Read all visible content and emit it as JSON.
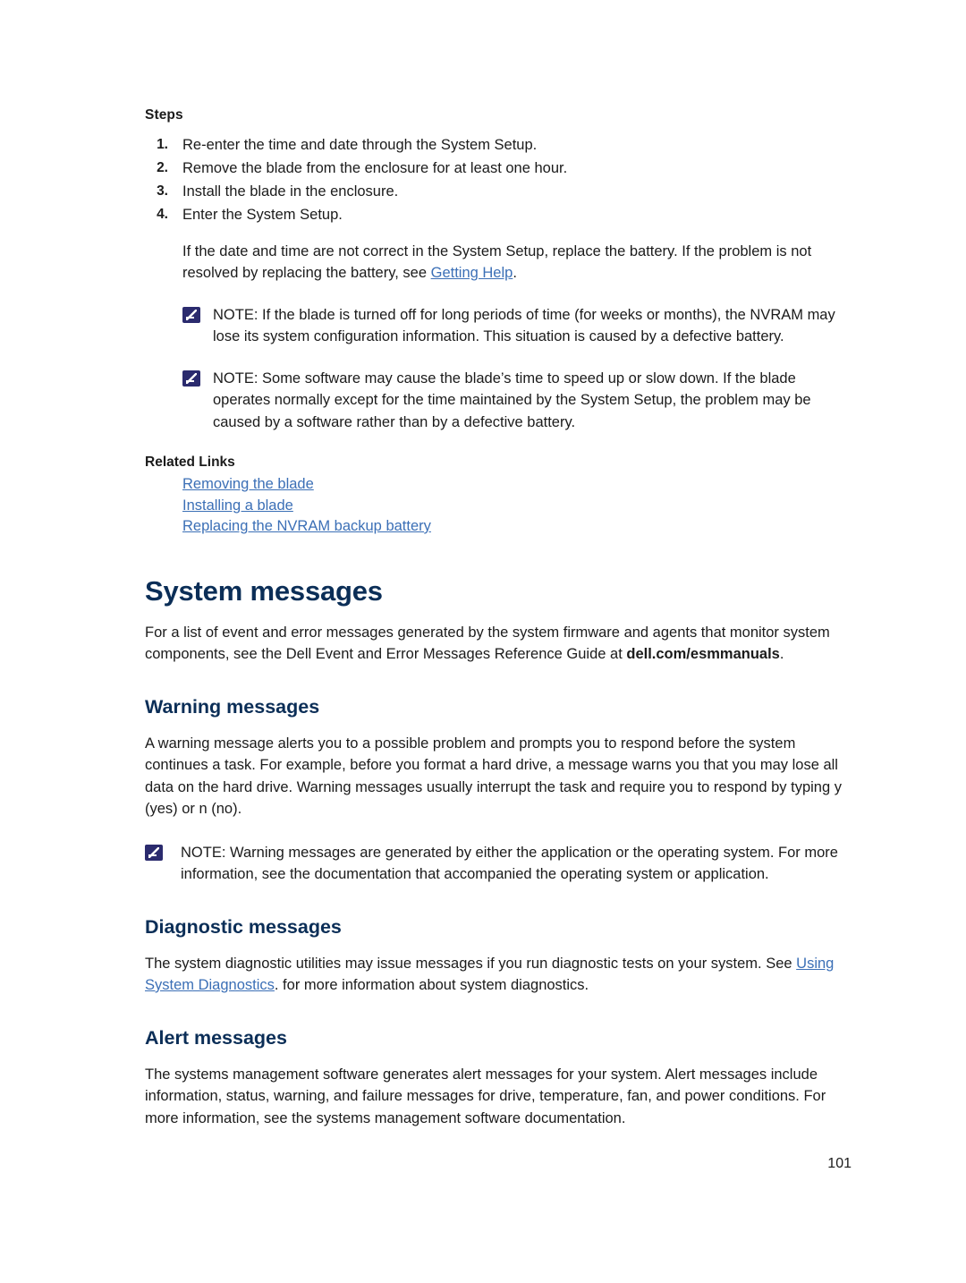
{
  "steps": {
    "label": "Steps",
    "items": [
      "Re-enter the time and date through the System Setup.",
      "Remove the blade from the enclosure for at least one hour.",
      "Install the blade in the enclosure.",
      "Enter the System Setup."
    ],
    "numbers": [
      "1.",
      "2.",
      "3.",
      "4."
    ],
    "follow_up": {
      "text_before": "If the date and time are not correct in the System Setup, replace the battery. If the problem is not resolved by replacing the battery, see ",
      "link": "Getting Help",
      "text_after": "."
    }
  },
  "notes": [
    {
      "label": "NOTE:",
      "text": " If the blade is turned off for long periods of time (for weeks or months), the NVRAM may lose its system configuration information. This situation is caused by a defective battery."
    },
    {
      "label": "NOTE:",
      "text": " Some software may cause the blade’s time to speed up or slow down. If the blade operates normally except for the time maintained by the System Setup, the problem may be caused by a software rather than by a defective battery."
    }
  ],
  "related": {
    "label": "Related Links",
    "links": [
      "Removing the blade",
      "Installing a blade",
      "Replacing the NVRAM backup battery"
    ]
  },
  "system_messages": {
    "heading": "System messages",
    "intro_before": "For a list of event and error messages generated by the system firmware and agents that monitor system components, see the Dell Event and Error Messages Reference Guide at ",
    "intro_bold": "dell.com/esmmanuals",
    "intro_after": "."
  },
  "warning_messages": {
    "heading": "Warning messages",
    "body": "A warning message alerts you to a possible problem and prompts you to respond before the system continues a task. For example, before you format a hard drive, a message warns you that you may lose all data on the hard drive. Warning messages usually interrupt the task and require you to respond by typing y (yes) or n (no).",
    "note": {
      "label": "NOTE:",
      "text": " Warning messages are generated by either the application or the operating system. For more information, see the documentation that accompanied the operating system or application."
    }
  },
  "diagnostic_messages": {
    "heading": "Diagnostic messages",
    "text_before": "The system diagnostic utilities may issue messages if you run diagnostic tests on your system. See ",
    "link": "Using System Diagnostics",
    "text_after": ". for more information about system diagnostics."
  },
  "alert_messages": {
    "heading": "Alert messages",
    "body": "The systems management software generates alert messages for your system. Alert messages include information, status, warning, and failure messages for drive, temperature, fan, and power conditions. For more information, see the systems management software documentation."
  },
  "footer": {
    "page_number": "101"
  },
  "colors": {
    "heading": "#0b2e57",
    "link": "#3b6fb6",
    "note_icon": "#2b2b6e",
    "text": "#1b1b1b"
  }
}
